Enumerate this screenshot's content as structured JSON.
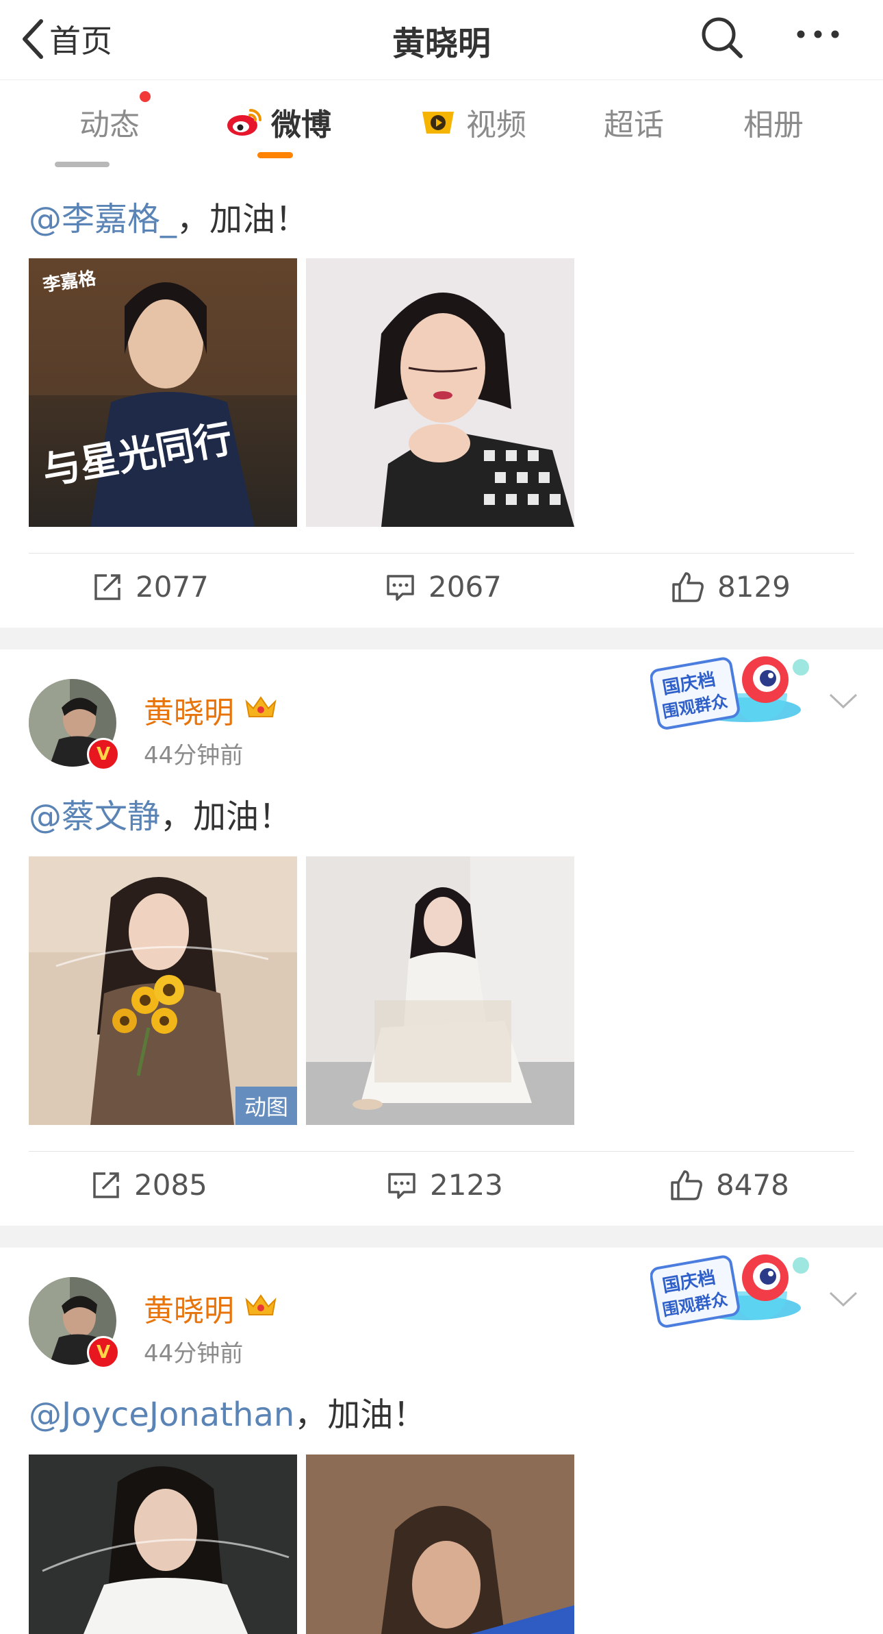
{
  "nav": {
    "back_label": "首页",
    "title": "黄晓明",
    "search_icon": "search-icon",
    "more_icon": "more-icon"
  },
  "tabs": [
    {
      "label": "动态",
      "has_dot": true
    },
    {
      "label": "微博",
      "active": true,
      "icon": "weibo-icon"
    },
    {
      "label": "视频",
      "icon": "video-icon"
    },
    {
      "label": "超话"
    },
    {
      "label": "相册"
    }
  ],
  "posts": [
    {
      "mention": "@李嘉格_",
      "text": "，加油！",
      "images": [
        {
          "overlay_name": "李嘉格",
          "overlay_text": "与星光同行"
        },
        {}
      ],
      "actions": {
        "repost": "2077",
        "comment": "2067",
        "like": "8129"
      }
    },
    {
      "author": "黄晓明",
      "time": "44分钟前",
      "mention": "@蔡文静",
      "text": "，加油！",
      "images": [
        {
          "badge": "动图"
        },
        {}
      ],
      "actions": {
        "repost": "2085",
        "comment": "2123",
        "like": "8478"
      }
    },
    {
      "author": "黄晓明",
      "time": "44分钟前",
      "mention": "@JoyceJonathan",
      "text": "，加油！",
      "images": [
        {},
        {}
      ]
    }
  ],
  "sticker": {
    "line1": "国庆档",
    "line2": "围观群众"
  },
  "colors": {
    "accent": "#ff8200",
    "mention": "#5a84b5",
    "username": "#e8740c",
    "dot": "#f33838"
  }
}
